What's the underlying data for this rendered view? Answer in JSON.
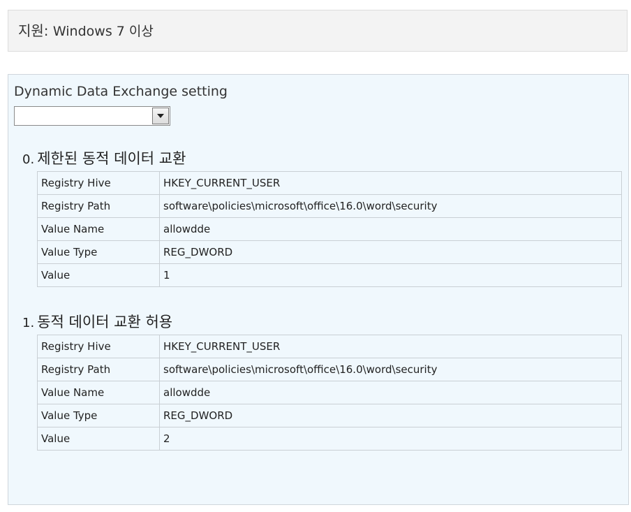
{
  "support": {
    "label": "지원:",
    "os": "Windows 7 이상"
  },
  "setting": {
    "label": "Dynamic Data Exchange setting",
    "selected_value": ""
  },
  "options": [
    {
      "index": "0.",
      "title": "제한된 동적 데이터 교환",
      "rows": [
        {
          "key": "Registry Hive",
          "value": "HKEY_CURRENT_USER"
        },
        {
          "key": "Registry Path",
          "value": "software\\policies\\microsoft\\office\\16.0\\word\\security"
        },
        {
          "key": "Value Name",
          "value": "allowdde"
        },
        {
          "key": "Value Type",
          "value": "REG_DWORD"
        },
        {
          "key": "Value",
          "value": "1"
        }
      ]
    },
    {
      "index": "1.",
      "title": "동적 데이터 교환 허용",
      "rows": [
        {
          "key": "Registry Hive",
          "value": "HKEY_CURRENT_USER"
        },
        {
          "key": "Registry Path",
          "value": "software\\policies\\microsoft\\office\\16.0\\word\\security"
        },
        {
          "key": "Value Name",
          "value": "allowdde"
        },
        {
          "key": "Value Type",
          "value": "REG_DWORD"
        },
        {
          "key": "Value",
          "value": "2"
        }
      ]
    }
  ]
}
